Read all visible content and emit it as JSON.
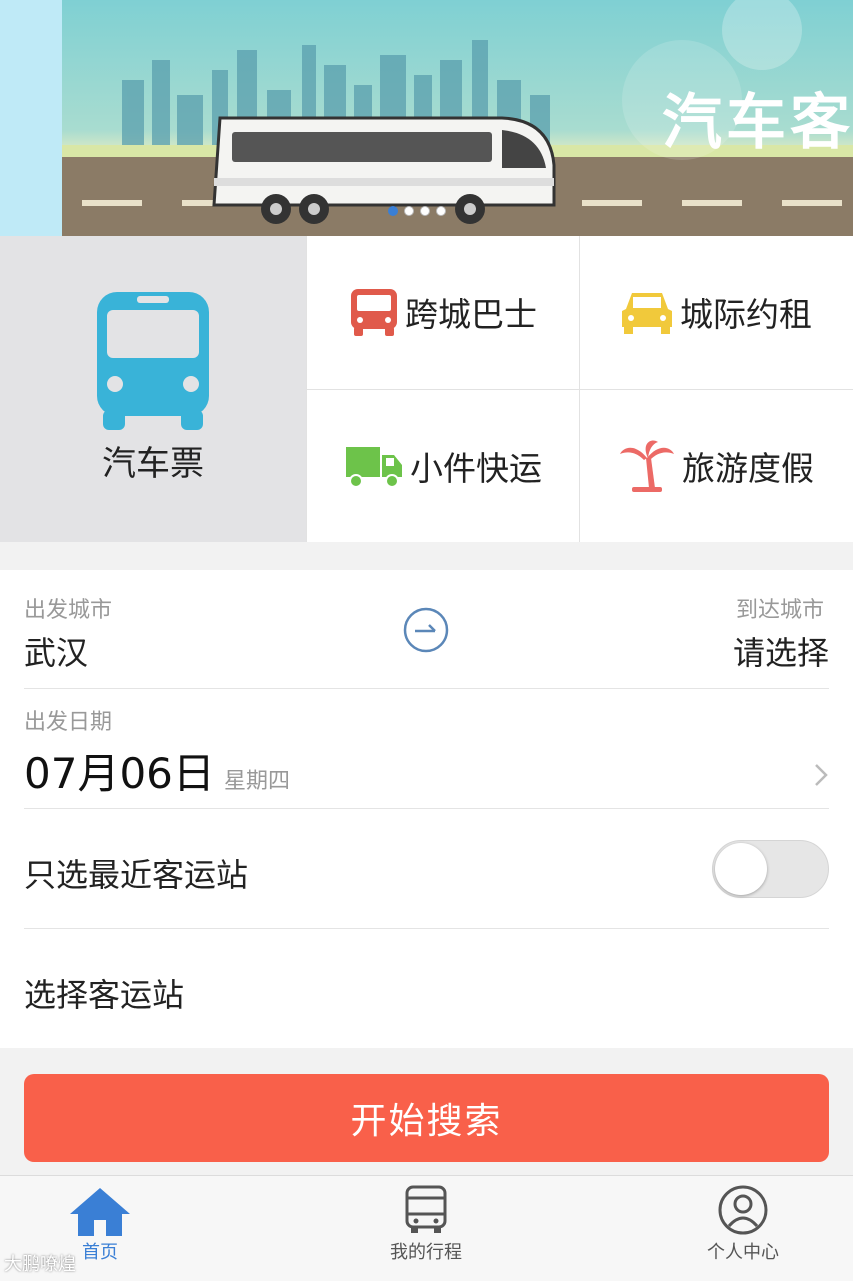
{
  "banner": {
    "text": "汽车客运",
    "dots": 4,
    "active_dot": 1
  },
  "grid": {
    "ticket": {
      "label": "汽车票",
      "icon": "bus-icon"
    },
    "items": [
      {
        "label": "跨城巴士",
        "icon": "bus-front-icon"
      },
      {
        "label": "城际约租",
        "icon": "car-front-icon"
      },
      {
        "label": "小件快运",
        "icon": "truck-icon"
      },
      {
        "label": "旅游度假",
        "icon": "palm-tree-icon"
      }
    ]
  },
  "form": {
    "from_label": "出发城市",
    "from_value": "武汉",
    "to_label": "到达城市",
    "to_value": "请选择",
    "date_label": "出发日期",
    "date_value": "07月06日",
    "weekday": "星期四",
    "nearest_label": "只选最近客运站",
    "nearest_on": false,
    "station_label": "选择客运站"
  },
  "search_button": "开始搜索",
  "tabs": [
    {
      "label": "首页",
      "icon": "home-icon",
      "active": true
    },
    {
      "label": "我的行程",
      "icon": "trip-icon",
      "active": false
    },
    {
      "label": "个人中心",
      "icon": "user-icon",
      "active": false
    }
  ],
  "watermark": "大鹏嘹煌",
  "colors": {
    "accent": "#f9604a",
    "blue": "#3a7fd5",
    "bus_blue": "#39b3d8",
    "red_icon": "#e05a4b",
    "yellow_icon": "#f1c93b",
    "green_icon": "#6dc34a",
    "pink_icon": "#ec6a66"
  }
}
